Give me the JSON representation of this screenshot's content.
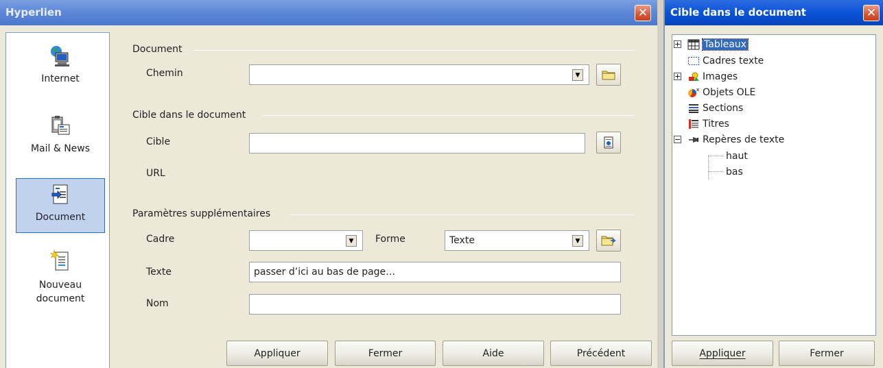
{
  "hyperlink_dialog": {
    "title": "Hyperlien",
    "categories": [
      {
        "label_lines": [
          "Internet"
        ],
        "icon": "globe-computer-icon",
        "selected": false
      },
      {
        "label_lines": [
          "Mail & News"
        ],
        "icon": "clipboard-mail-icon",
        "selected": false
      },
      {
        "label_lines": [
          "Document"
        ],
        "icon": "document-link-icon",
        "selected": true
      },
      {
        "label_lines": [
          "Nouveau",
          "document"
        ],
        "icon": "new-document-icon",
        "selected": false
      }
    ],
    "document_section": {
      "title": "Document",
      "path_label": "Chemin",
      "path_value": ""
    },
    "target_section": {
      "title": "Cible dans le document",
      "target_label": "Cible",
      "target_value": "",
      "url_label": "URL"
    },
    "extra_section": {
      "title": "Paramètres supplémentaires",
      "frame_label": "Cadre",
      "frame_value": "",
      "form_label": "Forme",
      "form_value": "Texte",
      "text_label": "Texte",
      "text_value": "passer d’ici au bas de page…",
      "name_label": "Nom",
      "name_value": ""
    },
    "buttons": {
      "apply": "Appliquer",
      "close": "Fermer",
      "help": "Aide",
      "previous": "Précédent"
    }
  },
  "target_dialog": {
    "title": "Cible dans le document",
    "tree": [
      {
        "label": "Tableaux",
        "icon": "table-icon",
        "expander": "+",
        "selected": true
      },
      {
        "label": "Cadres texte",
        "icon": "text-frame-icon",
        "expander": "",
        "selected": false
      },
      {
        "label": "Images",
        "icon": "images-icon",
        "expander": "+",
        "selected": false
      },
      {
        "label": "Objets OLE",
        "icon": "ole-object-icon",
        "expander": "",
        "selected": false
      },
      {
        "label": "Sections",
        "icon": "sections-icon",
        "expander": "",
        "selected": false
      },
      {
        "label": "Titres",
        "icon": "headings-icon",
        "expander": "",
        "selected": false
      },
      {
        "label": "Repères de texte",
        "icon": "bookmark-icon",
        "expander": "−",
        "selected": false
      },
      {
        "label": "haut",
        "icon": "",
        "expander": "",
        "selected": false
      },
      {
        "label": "bas",
        "icon": "",
        "expander": "",
        "selected": false
      }
    ],
    "buttons": {
      "apply": "Appliquer",
      "close": "Fermer"
    }
  }
}
